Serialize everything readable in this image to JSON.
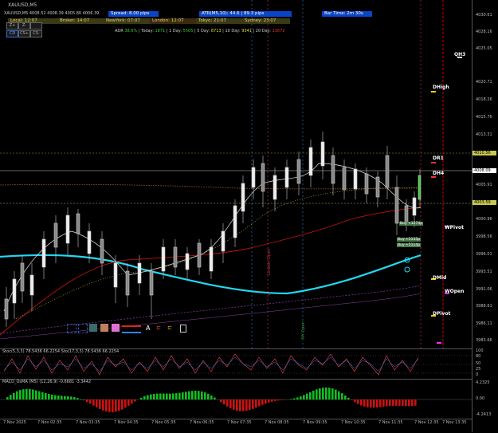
{
  "window_title": "XAUUSD,M5",
  "quote": "4008.52 4008.39 4005.80 4006.39",
  "spread": "Spread: 8.00 pips",
  "atr": "ATR(M5,10): 44.6",
  "atr_pips": "89.3 pips",
  "bar_time": "Bar Time: 2m 30s",
  "clocks": {
    "local": "Local: 12:07",
    "broker": "Broker: 14:07",
    "newyork": "NewYork: 07:07",
    "london": "London: 12:07",
    "tokyo": "Tokyo: 21:07",
    "sydney": "Sydney: 23:07"
  },
  "toolbar": {
    "row1": [
      "Z+",
      "Z-",
      "  "
    ],
    "row2": [
      "CD",
      "CS+",
      "CS-"
    ]
  },
  "adr_label": "ADR",
  "adr_value": "38.6%",
  "adr_today_label": "Today:",
  "adr_today": "1871",
  "adr_1day_label": "1 Day:",
  "adr_1day": "5505",
  "adr_5day_label": "5 Day:",
  "adr_5day": "8713",
  "adr_10day_label": "10 Day:",
  "adr_10day": "9341",
  "adr_20day_label": "20 Day:",
  "adr_20day": "11672",
  "price_axis": [
    "4030.61",
    "4028.16",
    "4025.05",
    "4020.71",
    "4018.26",
    "4015.76",
    "4013.31",
    "4010.86",
    "4008.09",
    "4005.91",
    "4003.46",
    "4000.96",
    "3998.56",
    "3996.01",
    "3993.51",
    "3991.06",
    "3988.61",
    "3986.11",
    "3983.66"
  ],
  "price_tags": [
    "4010.56",
    "4008.09",
    "4003.59"
  ],
  "levels": [
    "QH3",
    "DHigh",
    "DR1",
    "DH4",
    "WPivot",
    "DMid",
    "WOpen",
    "DPivot"
  ],
  "trades": [
    "Buy +1274p",
    "Buy +5135p",
    "Buy +5114p"
  ],
  "rsi_label": "Stoc(5,3,3) 78.5436 66.2254  Sto(17,3,3) 78.5436 66.2254",
  "rsi_axis": [
    "100",
    "80",
    "50",
    "25",
    "0"
  ],
  "macd_label": "MACD_OsMA (M5) (12,26,9) -0.6681 -3.3442",
  "macd_axis": [
    "4.2325",
    "0.00",
    "-4.2413"
  ],
  "time_axis": [
    "7 Nov 2025",
    "7 Nov 02:35",
    "7 Nov 03:35",
    "7 Nov 04:35",
    "7 Nov 05:35",
    "7 Nov 06:35",
    "7 Nov 07:35",
    "7 Nov 08:35",
    "7 Nov 09:35",
    "7 Nov 10:35",
    "7 Nov 11:35",
    "7 Nov 12:35",
    "7 Nov 13:35"
  ],
  "vertical_text_1": "London Open",
  "vertical_text_2": "NY Open",
  "colors": {
    "ma_cyan": "#20d8f0",
    "ma_red": "#c01010",
    "up_candle": "#e8e8e8",
    "down_candle": "#7a7a7a",
    "accent_blue": "#0a45c8"
  }
}
